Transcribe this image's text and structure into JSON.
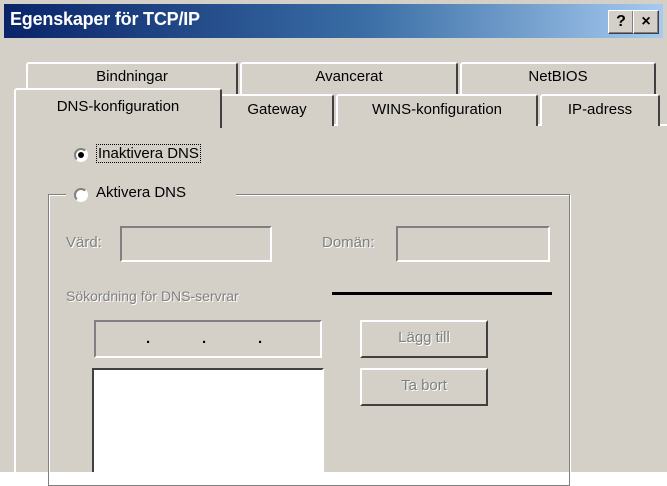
{
  "window": {
    "title": "Egenskaper för TCP/IP",
    "help_label": "?",
    "close_label": "×"
  },
  "tabs_back": [
    {
      "label": "Bindningar"
    },
    {
      "label": "Avancerat"
    },
    {
      "label": "NetBIOS"
    }
  ],
  "tabs_front": [
    {
      "label": "DNS-konfiguration",
      "selected": true
    },
    {
      "label": "Gateway"
    },
    {
      "label": "WINS-konfiguration"
    },
    {
      "label": "IP-adress"
    }
  ],
  "dns": {
    "disable_label": "Inaktivera DNS",
    "enable_label": "Aktivera DNS",
    "selected": "disable",
    "host_label": "Värd:",
    "host_value": "",
    "domain_label": "Domän:",
    "domain_value": "",
    "search_order_label": "Sökordning för DNS-servrar",
    "ip_dots": [
      ".",
      ".",
      "."
    ],
    "add_button": "Lägg till",
    "remove_button": "Ta bort",
    "server_list": []
  }
}
